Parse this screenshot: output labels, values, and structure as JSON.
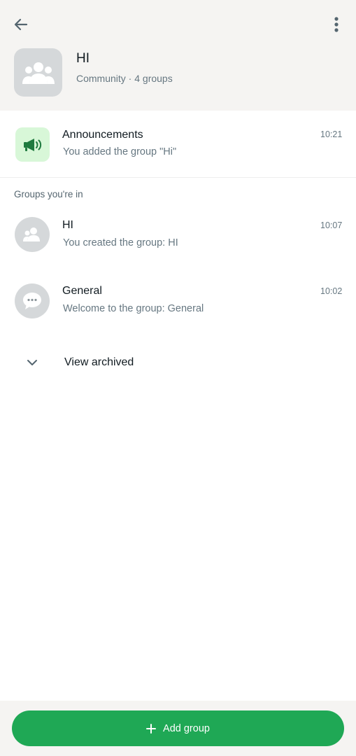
{
  "header": {
    "back_icon": "arrow-left-icon",
    "more_icon": "more-vertical-icon",
    "community_icon": "community-icon",
    "community_name": "HI",
    "community_subtitle": "Community · 4 groups"
  },
  "announcements": {
    "icon": "megaphone-icon",
    "title": "Announcements",
    "subtitle": "You added the group \"Hi\"",
    "time": "10:21"
  },
  "section_label": "Groups you're in",
  "groups": [
    {
      "name": "HI",
      "subtitle": "You created the group: HI",
      "time": "10:07",
      "icon": "group-icon"
    },
    {
      "name": "General",
      "subtitle": "Welcome to the group: General",
      "time": "10:02",
      "icon": "chat-bubble-icon"
    }
  ],
  "archived": {
    "label": "View archived",
    "icon": "chevron-down-icon"
  },
  "bottom": {
    "add_label": "Add group",
    "add_icon": "plus-icon"
  },
  "colors": {
    "accent": "#1fa855",
    "announcement_bg": "#d8f7d8",
    "announcement_icon": "#1f7a3f",
    "avatar_bg": "#d5d8da",
    "header_bg": "#f5f4f2"
  }
}
